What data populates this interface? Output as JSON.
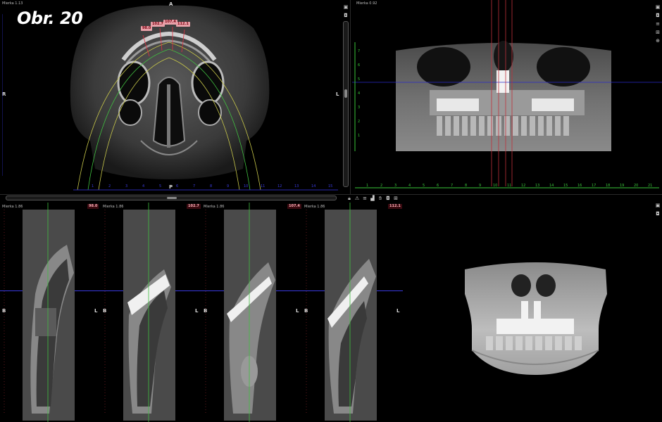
{
  "figure_label": "Obr. 20",
  "axial": {
    "scale": "Mierka 1.13",
    "top": "A",
    "bottom": "P",
    "left": "R",
    "right": "L",
    "tags": [
      "98.0",
      "102.7",
      "107.4",
      "112.1"
    ],
    "bottom_ticks": [
      "1",
      "2",
      "3",
      "4",
      "5",
      "6",
      "7",
      "8",
      "9",
      "10",
      "11",
      "12",
      "13",
      "14",
      "15"
    ]
  },
  "panoramic": {
    "scale": "Mierka 0.92",
    "left_ticks": [
      "7",
      "6",
      "5",
      "4",
      "3",
      "2",
      "1"
    ],
    "bottom_ticks": [
      "1",
      "2",
      "3",
      "4",
      "5",
      "6",
      "7",
      "8",
      "9",
      "10",
      "11",
      "12",
      "13",
      "14",
      "15",
      "16",
      "17",
      "18",
      "19",
      "20",
      "21"
    ]
  },
  "cross_sections": [
    {
      "scale": "Mierka 1.86",
      "tag": "98.0",
      "left": "B",
      "right": "L"
    },
    {
      "scale": "Mierka 1.86",
      "tag": "102.7",
      "left": "B",
      "right": "L"
    },
    {
      "scale": "Mierka 1.86",
      "tag": "107.4",
      "left": "B",
      "right": "L"
    },
    {
      "scale": "Mierka 1.86",
      "tag": "112.1",
      "left": "B",
      "right": "L"
    }
  ],
  "toolbar_icons": [
    "lock-icon",
    "warning-icon",
    "layers-icon",
    "crop-icon",
    "hand-icon",
    "camera-icon",
    "grid-icon"
  ],
  "colors": {
    "background": "#000000",
    "ruler": "#39c639",
    "red_line": "#c0303a",
    "blue_line": "#2a2aa0",
    "green_line": "#40c040",
    "tag": "#e8a0a8"
  }
}
